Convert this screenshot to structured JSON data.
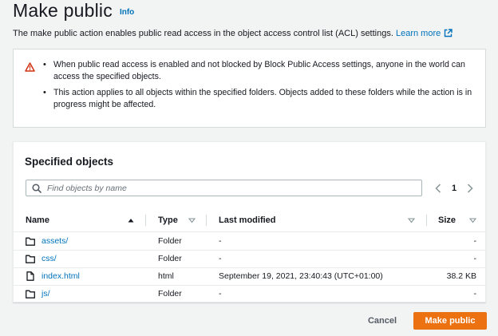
{
  "header": {
    "title": "Make public",
    "info_label": "Info",
    "description": "The make public action enables public read access in the object access control list (ACL) settings.",
    "learn_more": "Learn more"
  },
  "warning": {
    "icon": "warning-triangle-icon",
    "items": [
      "When public read access is enabled and not blocked by Block Public Access settings, anyone in the world can access the specified objects.",
      "This action applies to all objects within the specified folders. Objects added to these folders while the action is in progress might be affected."
    ]
  },
  "objects": {
    "title": "Specified objects",
    "search_placeholder": "Find objects by name",
    "page": "1",
    "columns": [
      "Name",
      "Type",
      "Last modified",
      "Size"
    ],
    "rows": [
      {
        "name": "assets/",
        "icon": "folder-icon",
        "type": "Folder",
        "last_modified": "-",
        "size": "-"
      },
      {
        "name": "css/",
        "icon": "folder-icon",
        "type": "Folder",
        "last_modified": "-",
        "size": "-"
      },
      {
        "name": "index.html",
        "icon": "file-icon",
        "type": "html",
        "last_modified": "September 19, 2021, 23:40:43 (UTC+01:00)",
        "size": "38.2 KB"
      },
      {
        "name": "js/",
        "icon": "folder-icon",
        "type": "Folder",
        "last_modified": "-",
        "size": "-"
      }
    ]
  },
  "footer": {
    "cancel_label": "Cancel",
    "primary_label": "Make public"
  },
  "colors": {
    "accent": "#ec7211",
    "link": "#0073bb",
    "warning": "#d13212",
    "background": "#f2f3f3"
  }
}
